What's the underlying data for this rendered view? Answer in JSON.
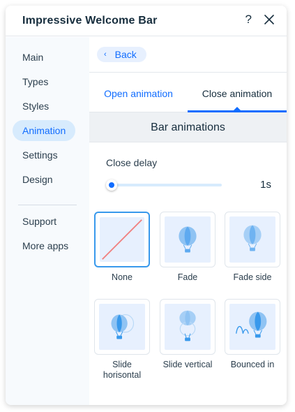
{
  "header": {
    "title": "Impressive Welcome Bar",
    "help_label": "?"
  },
  "sidebar": {
    "items": [
      {
        "label": "Main"
      },
      {
        "label": "Types"
      },
      {
        "label": "Styles"
      },
      {
        "label": "Animation"
      },
      {
        "label": "Settings"
      },
      {
        "label": "Design"
      }
    ],
    "footer_items": [
      {
        "label": "Support"
      },
      {
        "label": "More apps"
      }
    ],
    "active_item": "Animation"
  },
  "back": {
    "label": "Back"
  },
  "tabs": [
    {
      "label": "Open animation"
    },
    {
      "label": "Close animation"
    }
  ],
  "active_tab": "Close animation",
  "section": {
    "title": "Bar animations",
    "close_delay": {
      "label": "Close delay",
      "value_text": "1s",
      "fraction": 0
    }
  },
  "animations": [
    {
      "label": "None",
      "icon": "none-icon"
    },
    {
      "label": "Fade",
      "icon": "balloon-fade-icon"
    },
    {
      "label": "Fade side",
      "icon": "balloon-fade-side-icon"
    },
    {
      "label": "Slide horisontal",
      "icon": "balloon-slide-horizontal-icon"
    },
    {
      "label": "Slide vertical",
      "icon": "balloon-slide-vertical-icon"
    },
    {
      "label": "Bounced in",
      "icon": "balloon-bounce-icon"
    }
  ],
  "selected_animation": "None",
  "colors": {
    "accent": "#116dff",
    "active_bg": "#d7ebfd",
    "tile_bg": "#e7f0fe",
    "balloon": "#3899ec",
    "none_line": "#f08080"
  }
}
